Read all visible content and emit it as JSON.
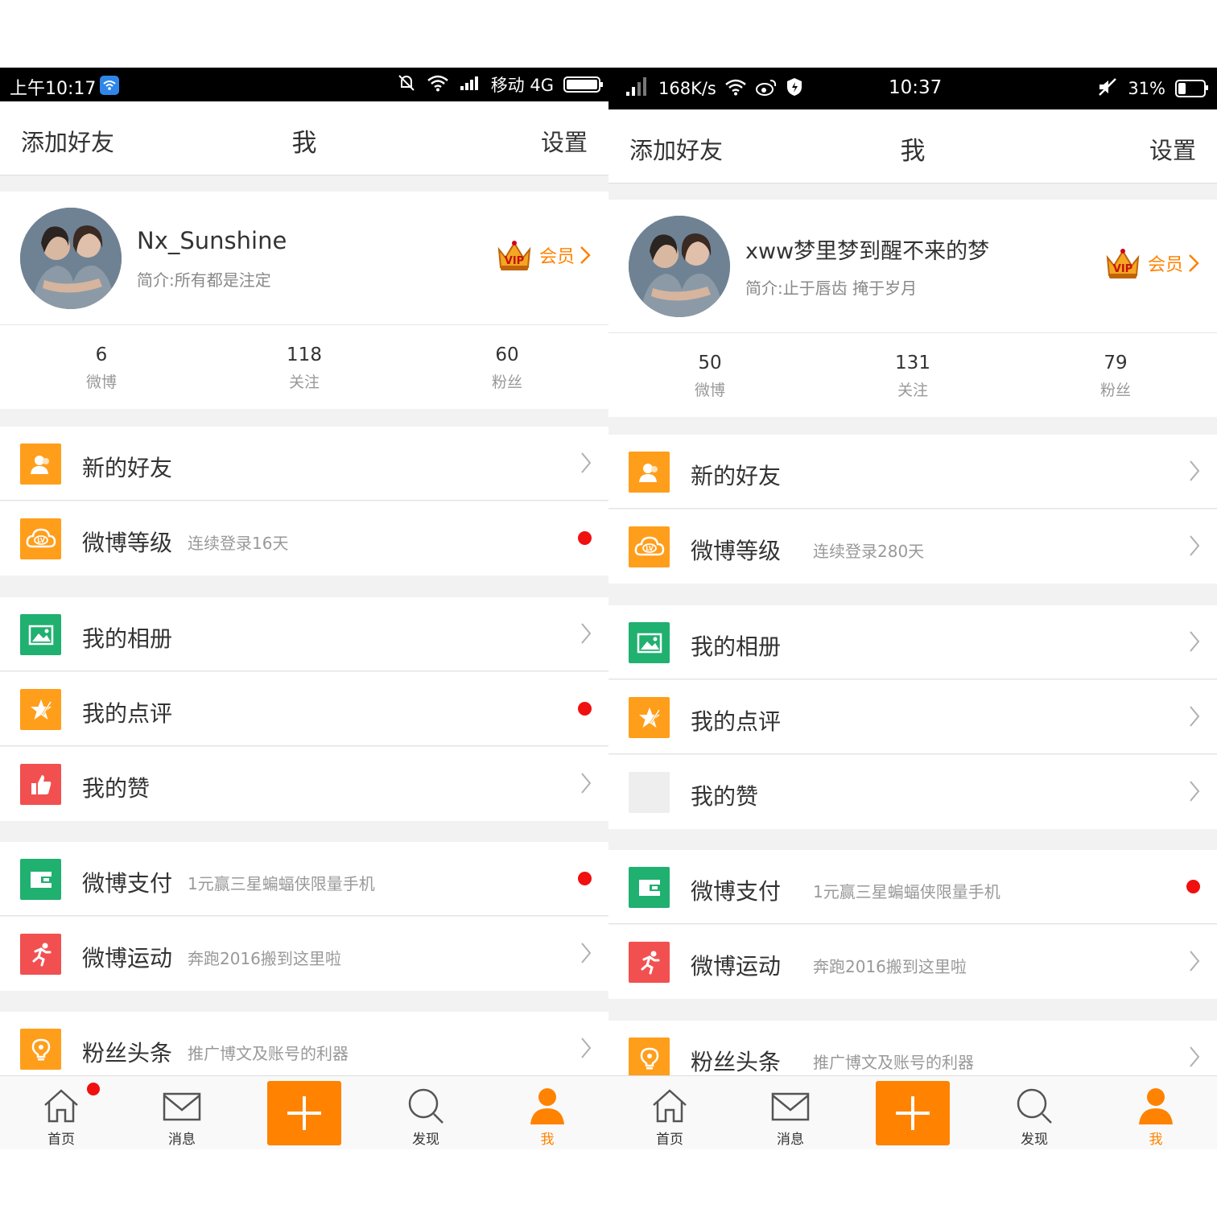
{
  "colors": {
    "accent": "#ff8200",
    "alert": "#f01010",
    "green": "#20b070",
    "red": "#f25050"
  },
  "left": {
    "status": {
      "time": "上午10:17",
      "carrier": "移动 4G",
      "battery_level": 1.0
    },
    "nav": {
      "left": "添加好友",
      "title": "我",
      "right": "设置"
    },
    "profile": {
      "name": "Nx_Sunshine",
      "bio": "简介:所有都是注定",
      "vip_label": "会员"
    },
    "stats": [
      {
        "count": "6",
        "label": "微博"
      },
      {
        "count": "118",
        "label": "关注"
      },
      {
        "count": "60",
        "label": "粉丝"
      }
    ],
    "menu": [
      {
        "label": "新的好友",
        "icon": "friends-icon"
      },
      {
        "label": "微博等级",
        "sub": "连续登录16天",
        "icon": "level-icon"
      },
      {
        "label": "我的相册",
        "icon": "album-icon"
      },
      {
        "label": "我的点评",
        "icon": "review-icon"
      },
      {
        "label": "我的赞",
        "icon": "thumbs-up-icon"
      },
      {
        "label": "微博支付",
        "sub": "1元赢三星蝙蝠侠限量手机",
        "icon": "wallet-icon"
      },
      {
        "label": "微博运动",
        "sub": "奔跑2016搬到这里啦",
        "icon": "running-icon"
      },
      {
        "label": "粉丝头条",
        "sub": "推广博文及账号的利器",
        "icon": "bulb-icon"
      }
    ],
    "tabs": [
      "首页",
      "消息",
      "发现",
      "我"
    ]
  },
  "right": {
    "status": {
      "speed": "168K/s",
      "time": "10:37",
      "battery": "31%",
      "battery_level": 0.31
    },
    "nav": {
      "left": "添加好友",
      "title": "我",
      "right": "设置"
    },
    "profile": {
      "name": "xww梦里梦到醒不来的梦",
      "bio": "简介:止于唇齿 掩于岁月",
      "vip_label": "会员"
    },
    "stats": [
      {
        "count": "50",
        "label": "微博"
      },
      {
        "count": "131",
        "label": "关注"
      },
      {
        "count": "79",
        "label": "粉丝"
      }
    ],
    "menu": [
      {
        "label": "新的好友",
        "icon": "friends-icon"
      },
      {
        "label": "微博等级",
        "sub": "连续登录280天",
        "icon": "level-icon"
      },
      {
        "label": "我的相册",
        "icon": "album-icon"
      },
      {
        "label": "我的点评",
        "icon": "review-icon"
      },
      {
        "label": "我的赞",
        "icon": "thumbs-up-icon"
      },
      {
        "label": "微博支付",
        "sub": "1元赢三星蝙蝠侠限量手机",
        "icon": "wallet-icon"
      },
      {
        "label": "微博运动",
        "sub": "奔跑2016搬到这里啦",
        "icon": "running-icon"
      },
      {
        "label": "粉丝头条",
        "sub": "推广博文及账号的利器",
        "icon": "bulb-icon"
      }
    ],
    "tabs": [
      "首页",
      "消息",
      "发现",
      "我"
    ]
  }
}
